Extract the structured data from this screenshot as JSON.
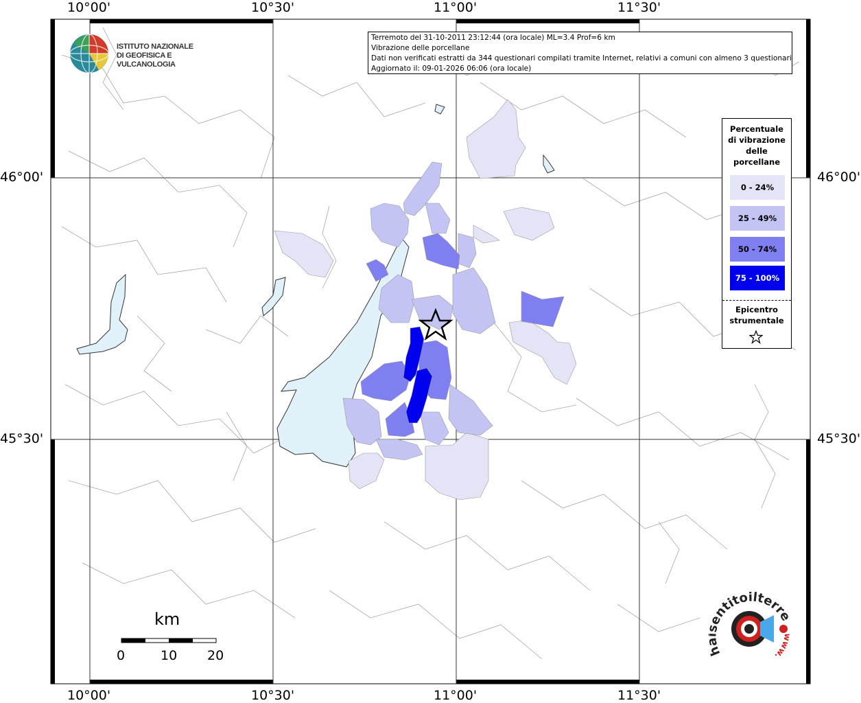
{
  "info": {
    "line1": "Terremoto del 31-10-2011 23:12:44 (ora locale) ML=3.4 Prof=6 km",
    "line2": "Vibrazione delle porcellane",
    "line3": "Dati non verificati estratti da 344 questionari compilati tramite Internet, relativi a comuni con almeno 3 questionari.",
    "line4": "Aggiornato il: 09-01-2026 06:06 (ora locale)"
  },
  "logo": {
    "line1": "ISTITUTO NAZIONALE",
    "line2": "DI GEOFISICA E VULCANOLOGIA"
  },
  "legend": {
    "title_lines": [
      "Percentuale",
      "di vibrazione",
      "delle",
      "porcellane"
    ],
    "classes": [
      {
        "label": "0 - 24%",
        "color": "#e4e4f7"
      },
      {
        "label": "25 - 49%",
        "color": "#c4c4f4"
      },
      {
        "label": "50 - 74%",
        "color": "#7f7ff1"
      },
      {
        "label": "75 - 100%",
        "color": "#0000ee"
      }
    ],
    "epicenter_lines": [
      "Epicentro",
      "strumentale"
    ],
    "epicenter_icon": "star-icon"
  },
  "axes": {
    "top_ticks": [
      "10°00'",
      "10°30'",
      "11°00'",
      "11°30'"
    ],
    "bottom_ticks": [
      "10°00'",
      "10°30'",
      "11°00'",
      "11°30'"
    ],
    "left_ticks": [
      "46°00'",
      "45°30'"
    ],
    "right_ticks": [
      "46°00'",
      "45°30'"
    ]
  },
  "scale_bar": {
    "unit": "km",
    "labels": [
      "0",
      "10",
      "20"
    ]
  },
  "badge": {
    "text": "haisentitoilterremoto.it",
    "prefix": "www."
  },
  "colors": {
    "lake": "#e0f1fa",
    "border": "#000000"
  }
}
